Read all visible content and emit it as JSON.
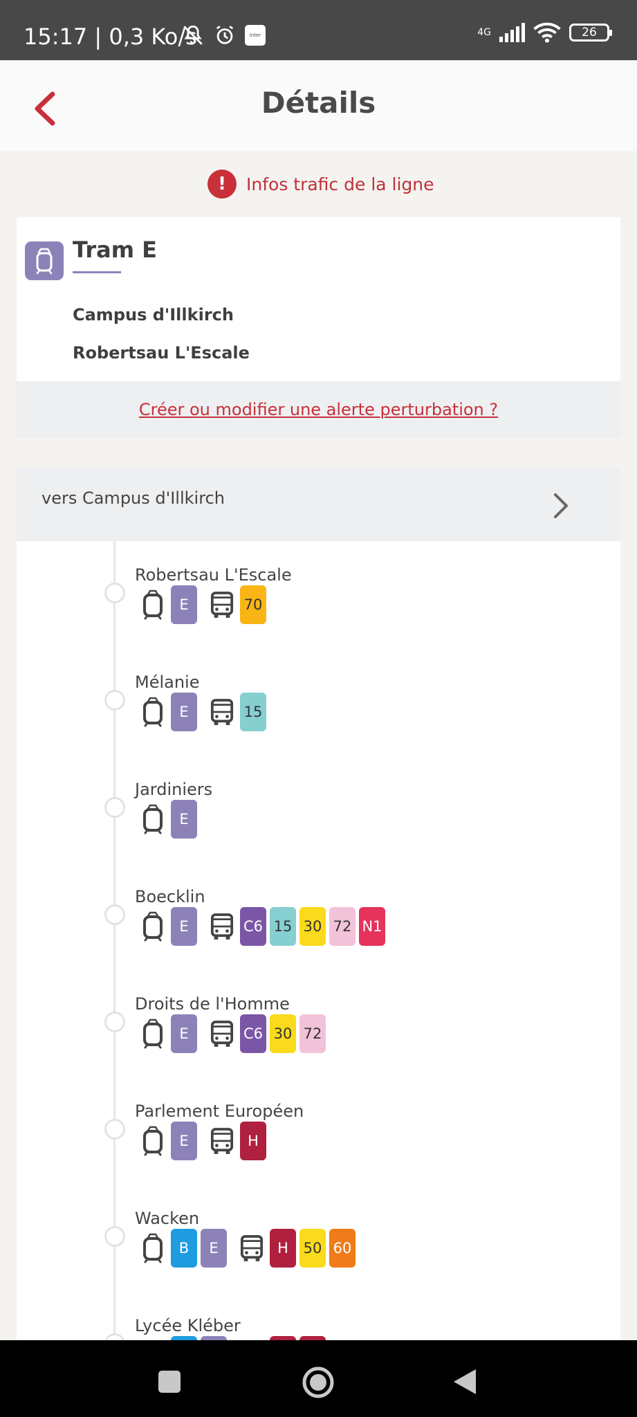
{
  "status_bar": {
    "time": "15:17 | 0,3 Ko/s",
    "network": "4G",
    "battery": "26",
    "app_badge": "inter"
  },
  "header": {
    "title": "Détails"
  },
  "traffic_info": {
    "label": "Infos trafic de la ligne",
    "icon_text": "!"
  },
  "line": {
    "name": "Tram E",
    "color": "#8d82b8",
    "destinations": [
      "Campus d'Illkirch",
      "Robertsau L'Escale"
    ]
  },
  "alert_link": "Créer ou modifier une alerte perturbation ?",
  "direction": {
    "label": "vers Campus d'Illkirch"
  },
  "stops": [
    {
      "name": "Robertsau L'Escale",
      "groups": [
        {
          "mode": "tram",
          "lines": [
            {
              "code": "E",
              "bg": "#8d82b8",
              "fg": "#ffffff"
            }
          ]
        },
        {
          "mode": "bus",
          "lines": [
            {
              "code": "70",
              "bg": "#f9b516",
              "fg": "#333333"
            }
          ]
        }
      ]
    },
    {
      "name": "Mélanie",
      "groups": [
        {
          "mode": "tram",
          "lines": [
            {
              "code": "E",
              "bg": "#8d82b8",
              "fg": "#ffffff"
            }
          ]
        },
        {
          "mode": "bus",
          "lines": [
            {
              "code": "15",
              "bg": "#86cfd0",
              "fg": "#333333"
            }
          ]
        }
      ]
    },
    {
      "name": "Jardiniers",
      "groups": [
        {
          "mode": "tram",
          "lines": [
            {
              "code": "E",
              "bg": "#8d82b8",
              "fg": "#ffffff"
            }
          ]
        }
      ]
    },
    {
      "name": "Boecklin",
      "groups": [
        {
          "mode": "tram",
          "lines": [
            {
              "code": "E",
              "bg": "#8d82b8",
              "fg": "#ffffff"
            }
          ]
        },
        {
          "mode": "bus",
          "lines": [
            {
              "code": "C6",
              "bg": "#7b56a6",
              "fg": "#ffffff"
            },
            {
              "code": "15",
              "bg": "#86cfd0",
              "fg": "#333333"
            },
            {
              "code": "30",
              "bg": "#f9da1c",
              "fg": "#333333"
            },
            {
              "code": "72",
              "bg": "#f2c3d8",
              "fg": "#333333"
            },
            {
              "code": "N1",
              "bg": "#e5335c",
              "fg": "#ffffff"
            }
          ]
        }
      ]
    },
    {
      "name": "Droits de l'Homme",
      "groups": [
        {
          "mode": "tram",
          "lines": [
            {
              "code": "E",
              "bg": "#8d82b8",
              "fg": "#ffffff"
            }
          ]
        },
        {
          "mode": "bus",
          "lines": [
            {
              "code": "C6",
              "bg": "#7b56a6",
              "fg": "#ffffff"
            },
            {
              "code": "30",
              "bg": "#f9da1c",
              "fg": "#333333"
            },
            {
              "code": "72",
              "bg": "#f2c3d8",
              "fg": "#333333"
            }
          ]
        }
      ]
    },
    {
      "name": "Parlement Européen",
      "groups": [
        {
          "mode": "tram",
          "lines": [
            {
              "code": "E",
              "bg": "#8d82b8",
              "fg": "#ffffff"
            }
          ]
        },
        {
          "mode": "bus",
          "lines": [
            {
              "code": "H",
              "bg": "#b0203f",
              "fg": "#ffffff"
            }
          ]
        }
      ]
    },
    {
      "name": "Wacken",
      "groups": [
        {
          "mode": "tram",
          "lines": [
            {
              "code": "B",
              "bg": "#1f9be0",
              "fg": "#ffffff"
            },
            {
              "code": "E",
              "bg": "#8d82b8",
              "fg": "#ffffff"
            }
          ]
        },
        {
          "mode": "bus",
          "lines": [
            {
              "code": "H",
              "bg": "#b0203f",
              "fg": "#ffffff"
            },
            {
              "code": "50",
              "bg": "#f9da1c",
              "fg": "#333333"
            },
            {
              "code": "60",
              "bg": "#ef7b1a",
              "fg": "#ffffff"
            }
          ]
        }
      ]
    },
    {
      "name": "Lycée Kléber",
      "groups": [
        {
          "mode": "tram",
          "lines": [
            {
              "code": "B",
              "bg": "#1f9be0",
              "fg": "#ffffff"
            },
            {
              "code": "E",
              "bg": "#8d82b8",
              "fg": "#ffffff"
            }
          ]
        },
        {
          "mode": "bus",
          "lines": [
            {
              "code": "H",
              "bg": "#b0203f",
              "fg": "#ffffff"
            },
            {
              "code": "H",
              "bg": "#b0203f",
              "fg": "#ffffff"
            }
          ]
        }
      ]
    }
  ],
  "colors": {
    "accent": "#c8303a",
    "line_e": "#8d82b8"
  }
}
